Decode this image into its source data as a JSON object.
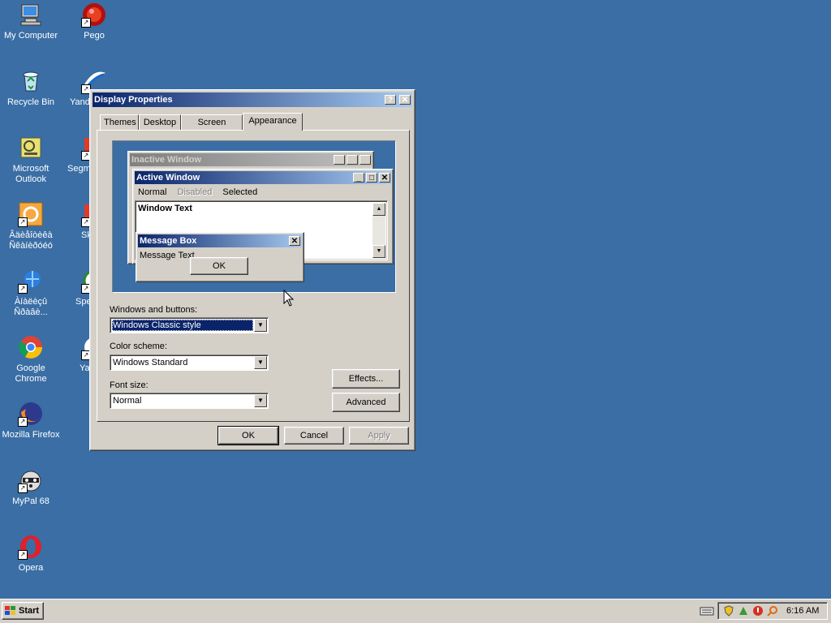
{
  "desktop": {
    "icons": [
      {
        "label": "My Computer"
      },
      {
        "label": "Recycle Bin"
      },
      {
        "label": "Microsoft Outlook"
      },
      {
        "label": "Âäèåîòèêà Ñêàíèðóéó"
      },
      {
        "label": "Àíàëèçû Ñðàâè..."
      },
      {
        "label": "Google Chrome"
      },
      {
        "label": "Mozilla Firefox"
      },
      {
        "label": "MyPal 68"
      },
      {
        "label": "Opera"
      },
      {
        "label": "Pego"
      },
      {
        "label": "Yand"
      },
      {
        "label": "Segm"
      },
      {
        "label": "Sk"
      },
      {
        "label": "Spe"
      },
      {
        "label": "Ya"
      }
    ]
  },
  "dialog": {
    "title": "Display Properties",
    "help_btn": "?",
    "close_btn": "✕",
    "tabs": [
      {
        "label": "Themes"
      },
      {
        "label": "Desktop"
      },
      {
        "label": "Screen Saver"
      },
      {
        "label": "Appearance"
      }
    ],
    "preview": {
      "inactive_title": "Inactive Window",
      "active_title": "Active Window",
      "menu": {
        "normal": "Normal",
        "disabled": "Disabled",
        "selected": "Selected"
      },
      "window_text": "Window Text",
      "msgbox_title": "Message Box",
      "msgbox_text": "Message Text",
      "msgbox_ok": "OK"
    },
    "windows_buttons_label": "Windows and buttons:",
    "windows_buttons_value": "Windows Classic style",
    "color_scheme_label": "Color scheme:",
    "color_scheme_value": "Windows Standard",
    "font_size_label": "Font size:",
    "font_size_value": "Normal",
    "effects_btn": "Effects...",
    "advanced_btn": "Advanced",
    "ok_btn": "OK",
    "cancel_btn": "Cancel",
    "apply_btn": "Apply"
  },
  "taskbar": {
    "start_label": "Start",
    "clock": "6:16 AM"
  },
  "colors": {
    "desktop": "#3a6ea5",
    "title_active": "#0a246a",
    "title_active_end": "#a6caf0",
    "title_inactive": "#808080",
    "face": "#d4d0c8"
  }
}
